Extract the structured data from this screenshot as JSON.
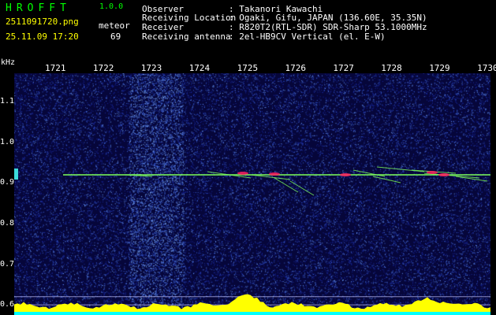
{
  "app": {
    "logo": "HROFFT",
    "version": "1.0.0"
  },
  "capture": {
    "filename": "2511091720.png",
    "datetime": "25.11.09 17:20",
    "count_label": "meteor",
    "count_value": "69"
  },
  "info": {
    "labels": [
      "Observer",
      "Receiving Location",
      "Receiver",
      "Receiving antenna"
    ],
    "values": [
      ": Takanori Kawachi",
      ": Ogaki, Gifu, JAPAN (136.60E, 35.35N)",
      ": R820T2(RTL-SDR) SDR-Sharp 53.1000MHz",
      ": 2el-HB9CV Vertical (el. E-W)"
    ]
  },
  "chart_data": {
    "type": "heatmap",
    "title": "",
    "ylabel": "kHz",
    "x_ticks": [
      "1721",
      "1722",
      "1723",
      "1724",
      "1725",
      "1726",
      "1727",
      "1728",
      "1729",
      "1730"
    ],
    "y_ticks": [
      "1.1",
      "1.0",
      "0.9",
      "0.8",
      "0.7",
      "0.6"
    ],
    "ylim": [
      0.575,
      1.17
    ],
    "carrier_khz": 0.92,
    "colors": {
      "noise_dark": "#06063a",
      "noise_mid": "#1a2aa0",
      "noise_light": "#3c64dc",
      "trace": "#7dff5a",
      "meteor_hot": "#ff2060",
      "lower_band": "#ffff00",
      "baseline": "#00ffff"
    }
  }
}
